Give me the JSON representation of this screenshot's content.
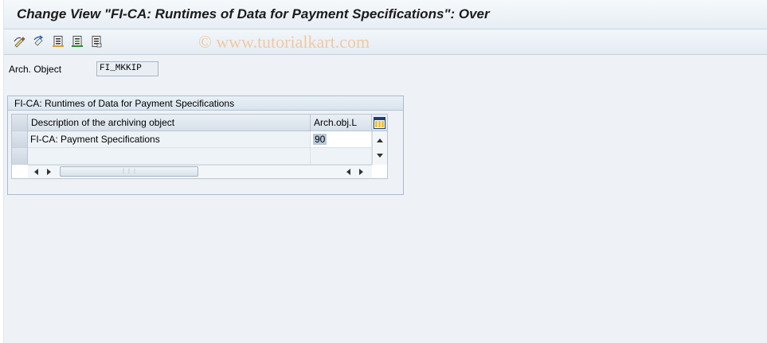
{
  "window": {
    "title": "Change View \"FI-CA: Runtimes of Data for Payment Specifications\": Over",
    "watermark": "© www.tutorialkart.com"
  },
  "toolbar": {
    "buttons": [
      {
        "icon": "display-change-icon"
      },
      {
        "icon": "undo-icon"
      },
      {
        "icon": "select-all-icon"
      },
      {
        "icon": "select-block-icon"
      },
      {
        "icon": "deselect-all-icon"
      }
    ]
  },
  "header_fields": {
    "arch_object_label": "Arch. Object",
    "arch_object_value": "FI_MKKIP"
  },
  "group": {
    "title": "FI-CA: Runtimes of Data for Payment Specifications"
  },
  "table": {
    "columns": [
      "Description of the archiving object",
      "Arch.obj.L"
    ],
    "rows": [
      {
        "description": "FI-CA: Payment Specifications",
        "arch_obj_l": "90"
      },
      {
        "description": "",
        "arch_obj_l": ""
      }
    ]
  },
  "colors": {
    "background": "#eef2f6",
    "header_bg": "#d7e0ea",
    "selected_value_bg": "#b9c9db"
  }
}
